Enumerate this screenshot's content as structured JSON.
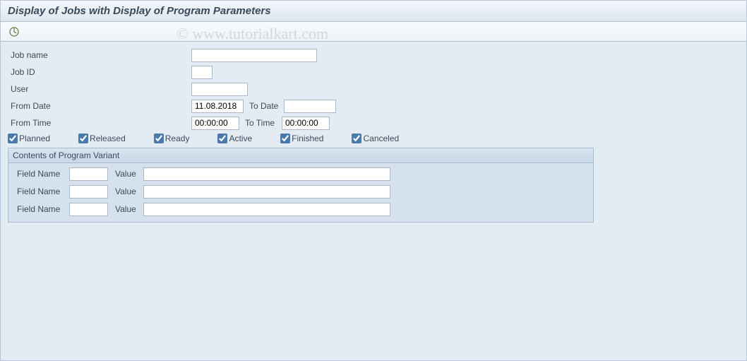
{
  "header": {
    "title": "Display of Jobs with Display of Program Parameters"
  },
  "watermark": "© www.tutorialkart.com",
  "form": {
    "jobname_label": "Job name",
    "jobname_value": "",
    "jobid_label": "Job ID",
    "jobid_value": "",
    "user_label": "User",
    "user_value": "",
    "fromdate_label": "From Date",
    "fromdate_value": "11.08.2018",
    "todate_label": "To Date",
    "todate_value": "",
    "fromtime_label": "From Time",
    "fromtime_value": "00:00:00",
    "totime_label": "To Time",
    "totime_value": "00:00:00"
  },
  "status": {
    "planned": "Planned",
    "released": "Released",
    "ready": "Ready",
    "active": "Active",
    "finished": "Finished",
    "canceled": "Canceled"
  },
  "group": {
    "title": "Contents of Program Variant",
    "rows": [
      {
        "fieldname_label": "Field Name",
        "fieldname_value": "",
        "value_label": "Value",
        "value_value": ""
      },
      {
        "fieldname_label": "Field Name",
        "fieldname_value": "",
        "value_label": "Value",
        "value_value": ""
      },
      {
        "fieldname_label": "Field Name",
        "fieldname_value": "",
        "value_label": "Value",
        "value_value": ""
      }
    ]
  }
}
